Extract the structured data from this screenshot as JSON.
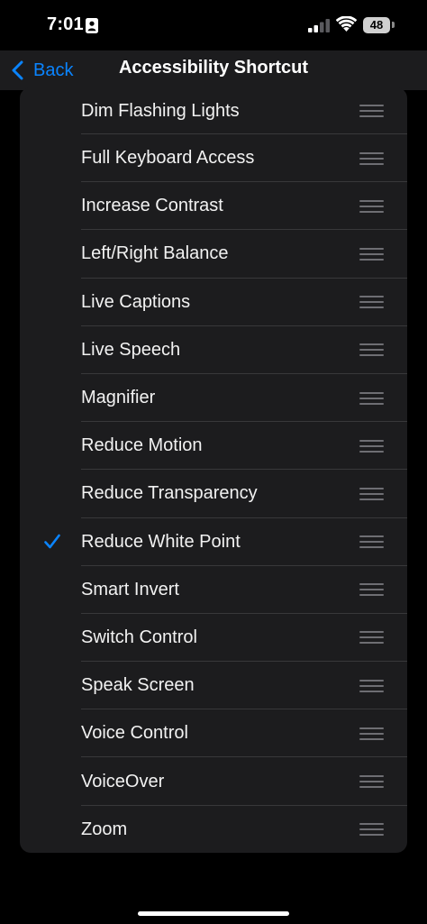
{
  "status_bar": {
    "time": "7:01",
    "battery": "48"
  },
  "nav": {
    "back_label": "Back",
    "title": "Accessibility Shortcut"
  },
  "colors": {
    "accent": "#0a84ff",
    "background": "#000000",
    "card": "#1c1c1e",
    "separator": "#38383a"
  },
  "items": [
    {
      "label": "Dim Flashing Lights",
      "checked": false
    },
    {
      "label": "Full Keyboard Access",
      "checked": false
    },
    {
      "label": "Increase Contrast",
      "checked": false
    },
    {
      "label": "Left/Right Balance",
      "checked": false
    },
    {
      "label": "Live Captions",
      "checked": false
    },
    {
      "label": "Live Speech",
      "checked": false
    },
    {
      "label": "Magnifier",
      "checked": false
    },
    {
      "label": "Reduce Motion",
      "checked": false
    },
    {
      "label": "Reduce Transparency",
      "checked": false
    },
    {
      "label": "Reduce White Point",
      "checked": true
    },
    {
      "label": "Smart Invert",
      "checked": false
    },
    {
      "label": "Switch Control",
      "checked": false
    },
    {
      "label": "Speak Screen",
      "checked": false
    },
    {
      "label": "Voice Control",
      "checked": false
    },
    {
      "label": "VoiceOver",
      "checked": false
    },
    {
      "label": "Zoom",
      "checked": false
    }
  ],
  "icons": {
    "check": "checkmark-icon",
    "reorder": "reorder-handle-icon"
  }
}
